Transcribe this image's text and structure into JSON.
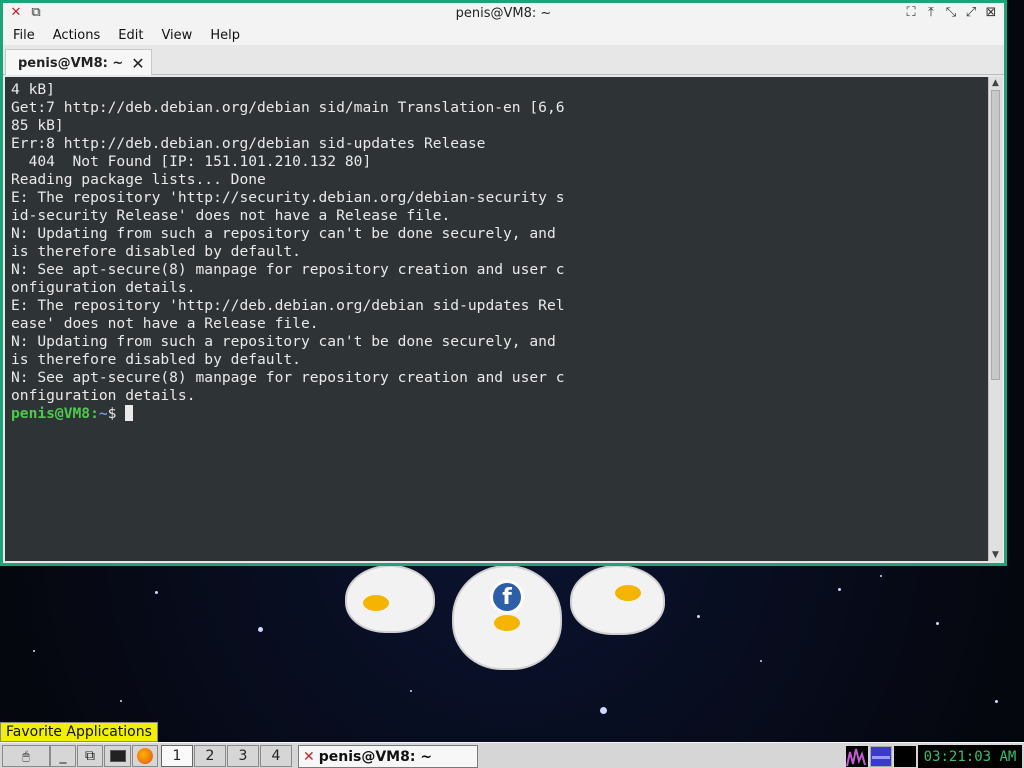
{
  "window": {
    "title": "penis@VM8: ~",
    "menu": [
      "File",
      "Actions",
      "Edit",
      "View",
      "Help"
    ],
    "tab_label": "penis@VM8: ~"
  },
  "terminal": {
    "lines": [
      "4 kB]",
      "Get:7 http://deb.debian.org/debian sid/main Translation-en [6,6",
      "85 kB]",
      "Err:8 http://deb.debian.org/debian sid-updates Release",
      "  404  Not Found [IP: 151.101.210.132 80]",
      "Reading package lists... Done",
      "E: The repository 'http://security.debian.org/debian-security s",
      "id-security Release' does not have a Release file.",
      "N: Updating from such a repository can't be done securely, and",
      "is therefore disabled by default.",
      "N: See apt-secure(8) manpage for repository creation and user c",
      "onfiguration details.",
      "E: The repository 'http://deb.debian.org/debian sid-updates Rel",
      "ease' does not have a Release file.",
      "N: Updating from such a repository can't be done securely, and",
      "is therefore disabled by default.",
      "N: See apt-secure(8) manpage for repository creation and user c",
      "onfiguration details."
    ],
    "prompt_user": "penis@VM8",
    "prompt_sep": ":",
    "prompt_path": "~",
    "prompt_symbol": "$ "
  },
  "tooltip": "Favorite Applications",
  "taskbar": {
    "workspaces": [
      "1",
      "2",
      "3",
      "4"
    ],
    "active_workspace": "1",
    "task_title": "penis@VM8: ~",
    "clock": "03:21:03 AM"
  },
  "colors": {
    "window_border": "#1ea27a",
    "terminal_bg": "#2e3436",
    "prompt_user": "#4ec94e",
    "clock_text": "#30c070"
  }
}
